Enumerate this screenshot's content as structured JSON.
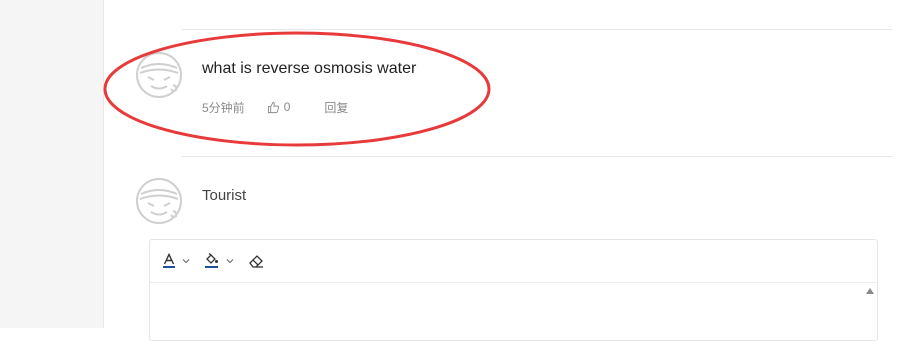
{
  "comment": {
    "text": "what is reverse osmosis water",
    "time": "5分钟前",
    "likes": "0",
    "reply_label": "回复"
  },
  "reply_form": {
    "user_name": "Tourist"
  },
  "editor": {
    "tools": [
      "font-color-icon",
      "highlight-color-icon",
      "eraser-icon"
    ]
  },
  "colors": {
    "highlight_ellipse": "#e83a3a",
    "font_color_underline": "#1f4f9c",
    "fill_color_underline": "#1f4f9c"
  }
}
